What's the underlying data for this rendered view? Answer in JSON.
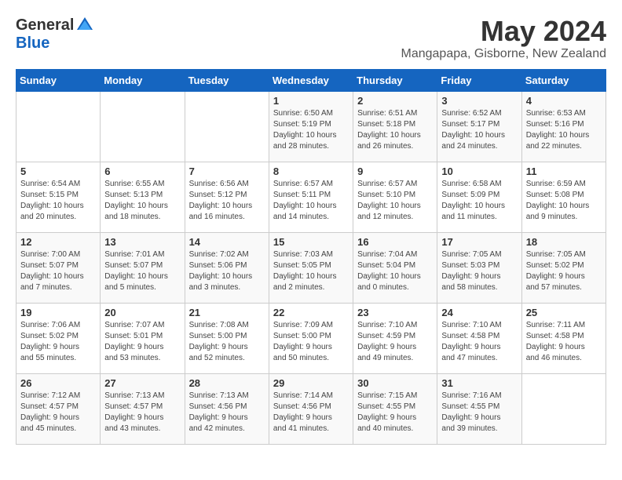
{
  "logo": {
    "general": "General",
    "blue": "Blue"
  },
  "title": "May 2024",
  "location": "Mangapapa, Gisborne, New Zealand",
  "days_of_week": [
    "Sunday",
    "Monday",
    "Tuesday",
    "Wednesday",
    "Thursday",
    "Friday",
    "Saturday"
  ],
  "weeks": [
    [
      {
        "day": "",
        "info": ""
      },
      {
        "day": "",
        "info": ""
      },
      {
        "day": "",
        "info": ""
      },
      {
        "day": "1",
        "info": "Sunrise: 6:50 AM\nSunset: 5:19 PM\nDaylight: 10 hours\nand 28 minutes."
      },
      {
        "day": "2",
        "info": "Sunrise: 6:51 AM\nSunset: 5:18 PM\nDaylight: 10 hours\nand 26 minutes."
      },
      {
        "day": "3",
        "info": "Sunrise: 6:52 AM\nSunset: 5:17 PM\nDaylight: 10 hours\nand 24 minutes."
      },
      {
        "day": "4",
        "info": "Sunrise: 6:53 AM\nSunset: 5:16 PM\nDaylight: 10 hours\nand 22 minutes."
      }
    ],
    [
      {
        "day": "5",
        "info": "Sunrise: 6:54 AM\nSunset: 5:15 PM\nDaylight: 10 hours\nand 20 minutes."
      },
      {
        "day": "6",
        "info": "Sunrise: 6:55 AM\nSunset: 5:13 PM\nDaylight: 10 hours\nand 18 minutes."
      },
      {
        "day": "7",
        "info": "Sunrise: 6:56 AM\nSunset: 5:12 PM\nDaylight: 10 hours\nand 16 minutes."
      },
      {
        "day": "8",
        "info": "Sunrise: 6:57 AM\nSunset: 5:11 PM\nDaylight: 10 hours\nand 14 minutes."
      },
      {
        "day": "9",
        "info": "Sunrise: 6:57 AM\nSunset: 5:10 PM\nDaylight: 10 hours\nand 12 minutes."
      },
      {
        "day": "10",
        "info": "Sunrise: 6:58 AM\nSunset: 5:09 PM\nDaylight: 10 hours\nand 11 minutes."
      },
      {
        "day": "11",
        "info": "Sunrise: 6:59 AM\nSunset: 5:08 PM\nDaylight: 10 hours\nand 9 minutes."
      }
    ],
    [
      {
        "day": "12",
        "info": "Sunrise: 7:00 AM\nSunset: 5:07 PM\nDaylight: 10 hours\nand 7 minutes."
      },
      {
        "day": "13",
        "info": "Sunrise: 7:01 AM\nSunset: 5:07 PM\nDaylight: 10 hours\nand 5 minutes."
      },
      {
        "day": "14",
        "info": "Sunrise: 7:02 AM\nSunset: 5:06 PM\nDaylight: 10 hours\nand 3 minutes."
      },
      {
        "day": "15",
        "info": "Sunrise: 7:03 AM\nSunset: 5:05 PM\nDaylight: 10 hours\nand 2 minutes."
      },
      {
        "day": "16",
        "info": "Sunrise: 7:04 AM\nSunset: 5:04 PM\nDaylight: 10 hours\nand 0 minutes."
      },
      {
        "day": "17",
        "info": "Sunrise: 7:05 AM\nSunset: 5:03 PM\nDaylight: 9 hours\nand 58 minutes."
      },
      {
        "day": "18",
        "info": "Sunrise: 7:05 AM\nSunset: 5:02 PM\nDaylight: 9 hours\nand 57 minutes."
      }
    ],
    [
      {
        "day": "19",
        "info": "Sunrise: 7:06 AM\nSunset: 5:02 PM\nDaylight: 9 hours\nand 55 minutes."
      },
      {
        "day": "20",
        "info": "Sunrise: 7:07 AM\nSunset: 5:01 PM\nDaylight: 9 hours\nand 53 minutes."
      },
      {
        "day": "21",
        "info": "Sunrise: 7:08 AM\nSunset: 5:00 PM\nDaylight: 9 hours\nand 52 minutes."
      },
      {
        "day": "22",
        "info": "Sunrise: 7:09 AM\nSunset: 5:00 PM\nDaylight: 9 hours\nand 50 minutes."
      },
      {
        "day": "23",
        "info": "Sunrise: 7:10 AM\nSunset: 4:59 PM\nDaylight: 9 hours\nand 49 minutes."
      },
      {
        "day": "24",
        "info": "Sunrise: 7:10 AM\nSunset: 4:58 PM\nDaylight: 9 hours\nand 47 minutes."
      },
      {
        "day": "25",
        "info": "Sunrise: 7:11 AM\nSunset: 4:58 PM\nDaylight: 9 hours\nand 46 minutes."
      }
    ],
    [
      {
        "day": "26",
        "info": "Sunrise: 7:12 AM\nSunset: 4:57 PM\nDaylight: 9 hours\nand 45 minutes."
      },
      {
        "day": "27",
        "info": "Sunrise: 7:13 AM\nSunset: 4:57 PM\nDaylight: 9 hours\nand 43 minutes."
      },
      {
        "day": "28",
        "info": "Sunrise: 7:13 AM\nSunset: 4:56 PM\nDaylight: 9 hours\nand 42 minutes."
      },
      {
        "day": "29",
        "info": "Sunrise: 7:14 AM\nSunset: 4:56 PM\nDaylight: 9 hours\nand 41 minutes."
      },
      {
        "day": "30",
        "info": "Sunrise: 7:15 AM\nSunset: 4:55 PM\nDaylight: 9 hours\nand 40 minutes."
      },
      {
        "day": "31",
        "info": "Sunrise: 7:16 AM\nSunset: 4:55 PM\nDaylight: 9 hours\nand 39 minutes."
      },
      {
        "day": "",
        "info": ""
      }
    ]
  ]
}
